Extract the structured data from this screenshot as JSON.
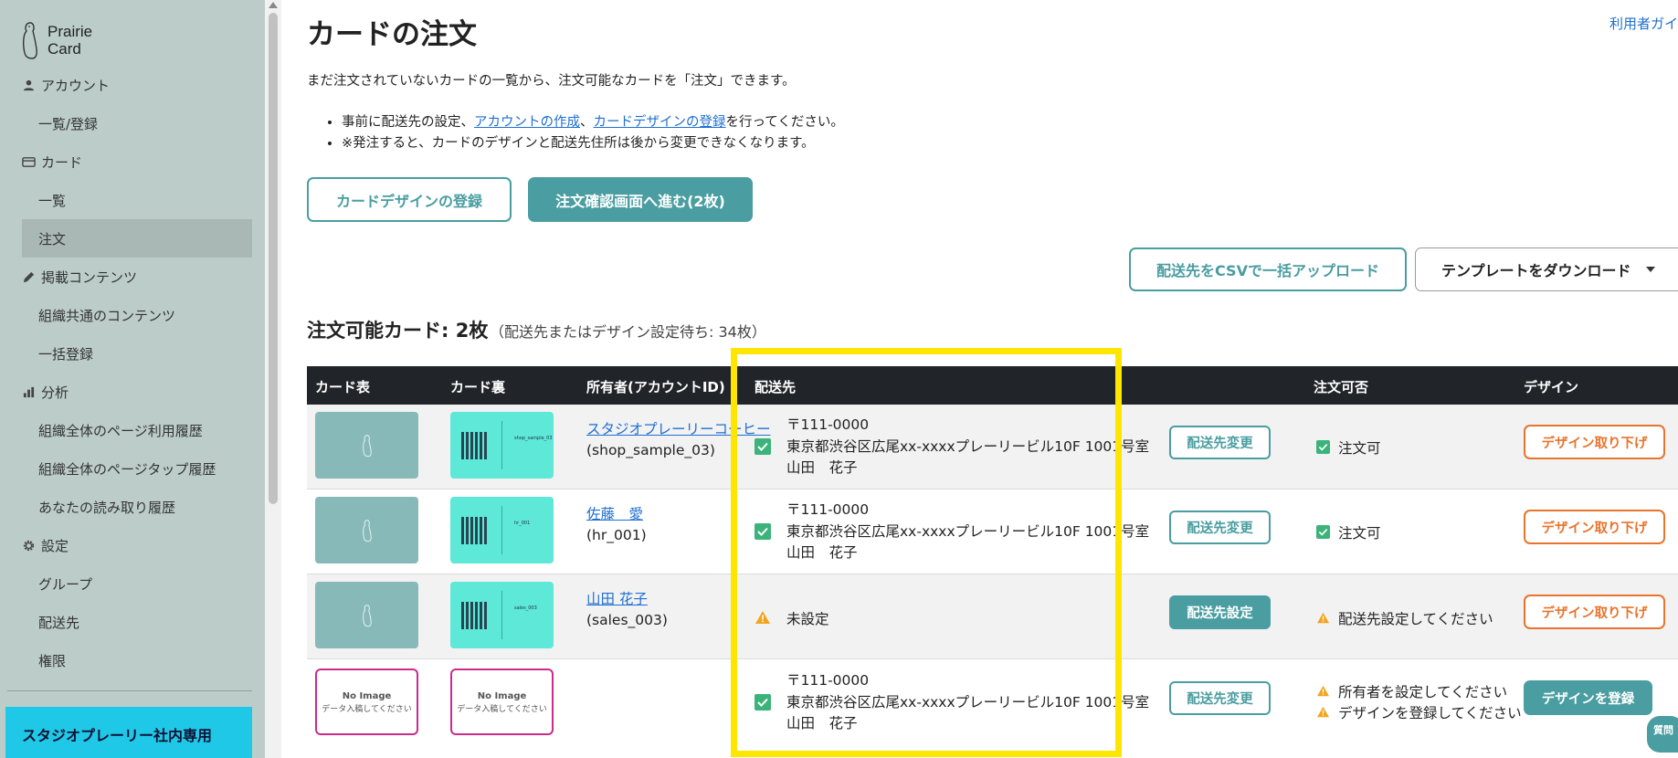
{
  "brand": {
    "line1": "Prairie",
    "line2": "Card"
  },
  "sidebar": {
    "sections": [
      {
        "label": "アカウント",
        "items": [
          "一覧/登録"
        ]
      },
      {
        "label": "カード",
        "items": [
          "一覧",
          "注文"
        ]
      },
      {
        "label": "掲載コンテンツ",
        "items": [
          "組織共通のコンテンツ",
          "一括登録"
        ]
      },
      {
        "label": "分析",
        "items": [
          "組織全体のページ利用履歴",
          "組織全体のページタップ履歴",
          "あなたの読み取り履歴"
        ]
      },
      {
        "label": "設定",
        "items": [
          "グループ",
          "配送先",
          "権限"
        ]
      }
    ],
    "notice": "スタジオプレーリー社内専用"
  },
  "header": {
    "title": "カードの注文",
    "help_link": "利用者ガイ"
  },
  "intro": {
    "lead": "まだ注文されていないカードの一覧から、注文可能なカードを「注文」できます。",
    "bullet1_prefix": "事前に配送先の設定、",
    "bullet1_link1": "アカウントの作成",
    "bullet1_sep": "、",
    "bullet1_link2": "カードデザインの登録",
    "bullet1_suffix": "を行ってください。",
    "bullet2": "※発注すると、カードのデザインと配送先住所は後から変更できなくなります。"
  },
  "actions": {
    "register_design": "カードデザインの登録",
    "proceed_order": "注文確認画面へ進む(2枚)",
    "csv_upload": "配送先をCSVで一括アップロード",
    "template_download": "テンプレートをダウンロード"
  },
  "summary": {
    "title": "注文可能カード: 2枚",
    "note": "（配送先またはデザイン設定待ち: 34枚）"
  },
  "table": {
    "headers": {
      "front": "カード表",
      "back": "カード裏",
      "owner": "所有者(アカウントID)",
      "address": "配送先",
      "orderable": "注文可否",
      "design": "デザイン"
    },
    "rows": [
      {
        "owner_name": "スタジオプレーリーコーヒー",
        "owner_id": "(shop_sample_03)",
        "back_mini": "shop_sample_03",
        "address": [
          "〒111-0000",
          "東京都渋谷区広尾xx-xxxxプレーリービル10F 1001号室",
          "山田　花子"
        ],
        "address_button": "配送先変更",
        "status": [
          "注文可"
        ],
        "design_button": "デザイン取り下げ"
      },
      {
        "owner_name": "佐藤　愛",
        "owner_id": "(hr_001)",
        "back_mini": "hr_001",
        "address": [
          "〒111-0000",
          "東京都渋谷区広尾xx-xxxxプレーリービル10F 1001号室",
          "山田　花子"
        ],
        "address_button": "配送先変更",
        "status": [
          "注文可"
        ],
        "design_button": "デザイン取り下げ"
      },
      {
        "owner_name": "山田 花子",
        "owner_id": "(sales_003)",
        "back_mini": "sales_003",
        "address_unset": "未設定",
        "address_button": "配送先設定",
        "status": [
          "配送先設定してください"
        ],
        "design_button": "デザイン取り下げ"
      },
      {
        "no_image_title": "No Image",
        "no_image_sub": "データ入稿してください",
        "address": [
          "〒111-0000",
          "東京都渋谷区広尾xx-xxxxプレーリービル10F 1001号室",
          "山田　花子"
        ],
        "address_button": "配送先変更",
        "status": [
          "所有者を設定してください",
          "デザインを登録してください"
        ],
        "design_button": "デザインを登録"
      }
    ]
  },
  "chat_badge": "質問",
  "colors": {
    "sidebar_bg": "#bccdc9",
    "accent_teal": "#4a9da0",
    "warning_orange": "#e8742c",
    "highlight_yellow": "#ffe600",
    "table_header": "#212529"
  },
  "icons": [
    "person-icon",
    "card-icon",
    "pencil-icon",
    "bar-chart-icon",
    "gear-icon",
    "check-icon",
    "warning-icon",
    "caret-down-icon"
  ]
}
